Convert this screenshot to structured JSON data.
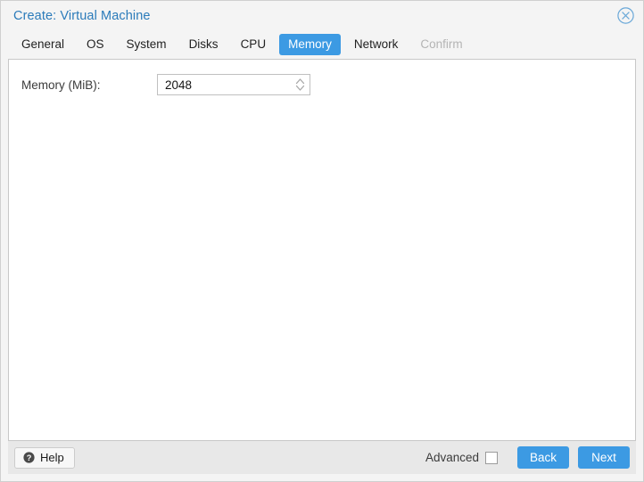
{
  "window": {
    "title": "Create: Virtual Machine",
    "close_icon": "close-circle-icon"
  },
  "tabs": [
    {
      "label": "General",
      "state": "normal"
    },
    {
      "label": "OS",
      "state": "normal"
    },
    {
      "label": "System",
      "state": "normal"
    },
    {
      "label": "Disks",
      "state": "normal"
    },
    {
      "label": "CPU",
      "state": "normal"
    },
    {
      "label": "Memory",
      "state": "active"
    },
    {
      "label": "Network",
      "state": "normal"
    },
    {
      "label": "Confirm",
      "state": "disabled"
    }
  ],
  "form": {
    "memory": {
      "label": "Memory (MiB):",
      "value": "2048",
      "placeholder": "",
      "spinner_icon": "spinner-up-down-icon"
    }
  },
  "toolbar": {
    "help_label": "Help",
    "help_icon": "question-mark-circle-icon",
    "advanced_label": "Advanced",
    "advanced_checked": false,
    "back_label": "Back",
    "next_label": "Next"
  },
  "colors": {
    "accent": "#3c9ae3",
    "title_text": "#2b7bba",
    "chrome_bg": "#f4f4f4",
    "toolbar_bg": "#e8e8e8",
    "content_bg": "#ffffff",
    "disabled_text": "#b4b4b4",
    "border": "#c8c8c8"
  }
}
